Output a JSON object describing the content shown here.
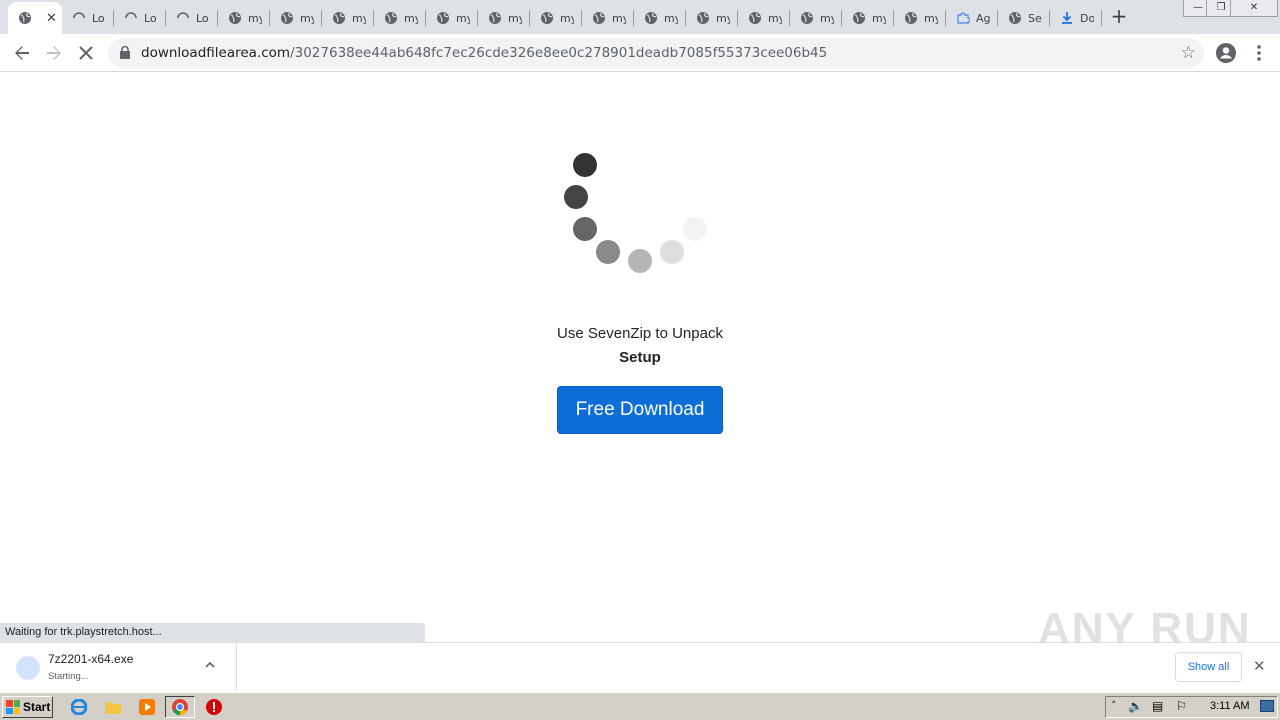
{
  "browser": {
    "tabs": [
      {
        "title": "",
        "icon": "globe-icon",
        "active": true
      },
      {
        "title": "Lo",
        "icon": "loading-spinner-icon"
      },
      {
        "title": "Lo",
        "icon": "loading-spinner-icon"
      },
      {
        "title": "Lo",
        "icon": "loading-spinner-icon"
      },
      {
        "title": "my",
        "icon": "globe-icon"
      },
      {
        "title": "my",
        "icon": "globe-icon"
      },
      {
        "title": "my",
        "icon": "globe-icon"
      },
      {
        "title": "my",
        "icon": "globe-icon"
      },
      {
        "title": "my",
        "icon": "globe-icon"
      },
      {
        "title": "my",
        "icon": "globe-icon"
      },
      {
        "title": "my",
        "icon": "globe-icon"
      },
      {
        "title": "my",
        "icon": "globe-icon"
      },
      {
        "title": "my",
        "icon": "globe-icon"
      },
      {
        "title": "my",
        "icon": "globe-icon"
      },
      {
        "title": "my",
        "icon": "globe-icon"
      },
      {
        "title": "my",
        "icon": "globe-icon"
      },
      {
        "title": "my",
        "icon": "globe-icon"
      },
      {
        "title": "my",
        "icon": "globe-icon"
      },
      {
        "title": "Ag",
        "icon": "puzzle-icon"
      },
      {
        "title": "Se",
        "icon": "globe-icon"
      },
      {
        "title": "Do",
        "icon": "download-icon"
      }
    ],
    "url_domain": "downloadfilearea.com",
    "url_path": "/3027638ee44ab648fc7ec26cde326e8ee0c278901deadb7085f55373cee06b45",
    "status_text": "Waiting for trk.playstretch.host..."
  },
  "page": {
    "message": "Use SevenZip to Unpack",
    "message_bold": "Setup",
    "download_button": "Free Download"
  },
  "downloads": {
    "file_name": "7z2201-x64.exe",
    "state": "Starting...",
    "show_all": "Show all"
  },
  "watermark": "ANY RUN",
  "taskbar": {
    "start_label": "Start",
    "clock": "3:11 AM"
  },
  "colors": {
    "accent": "#0d6ed8",
    "tabstrip": "#dee1e6",
    "taskbar": "#d4d0c8"
  }
}
